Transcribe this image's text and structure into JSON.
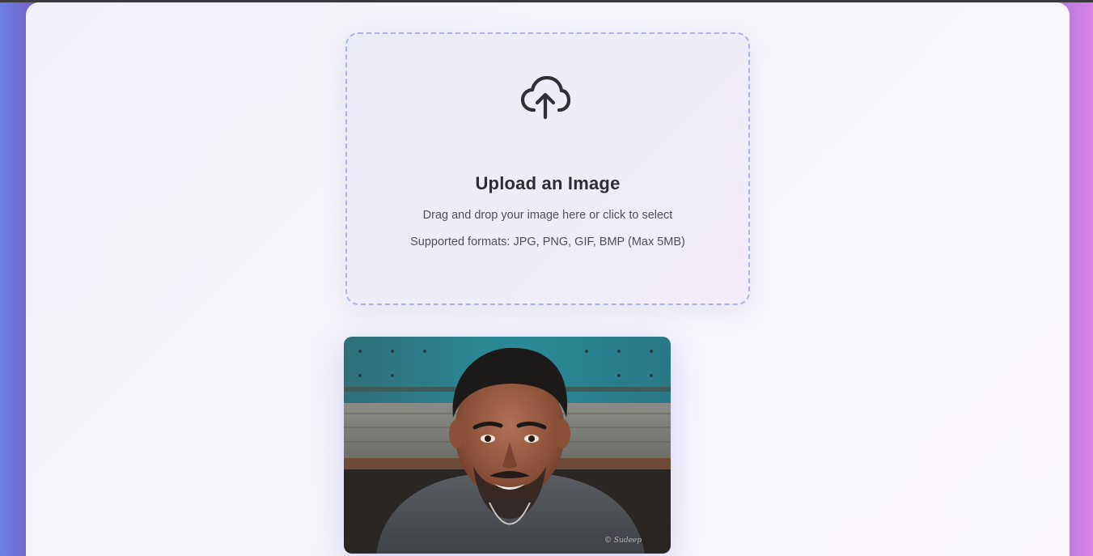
{
  "upload": {
    "icon": "cloud-upload-icon",
    "title": "Upload an Image",
    "hint": "Drag and drop your image here or click to select",
    "formats": "Supported formats: JPG, PNG, GIF, BMP (Max 5MB)"
  },
  "preview": {
    "image_alt": "Uploaded portrait of a smiling man",
    "watermark": "© Sudeep"
  },
  "colors": {
    "accent_border": "#a9b3ec",
    "background_left": "#6a7fe6",
    "background_right": "#d884e8"
  }
}
